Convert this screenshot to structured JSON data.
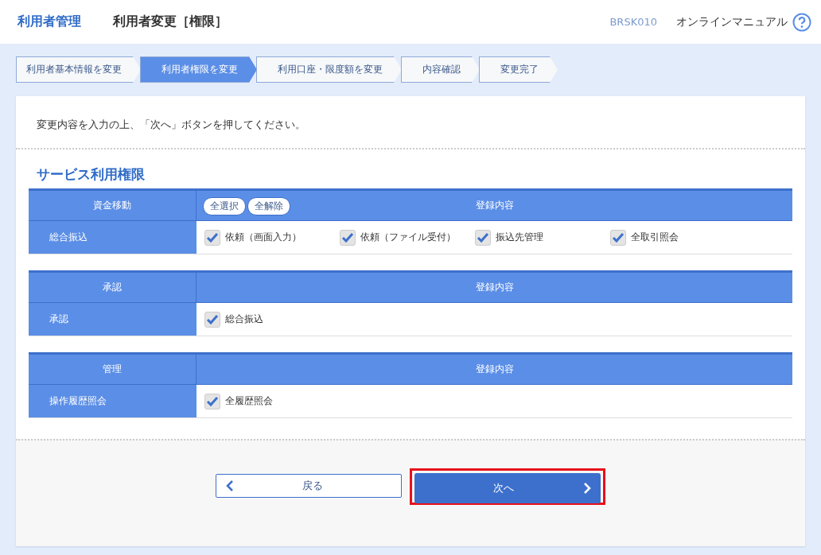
{
  "header": {
    "section": "利用者管理",
    "title": "利用者変更［権限］",
    "screen_id": "BRSK010",
    "manual_link": "オンラインマニュアル"
  },
  "steps": [
    {
      "label": "利用者基本情報を変更",
      "selected": false
    },
    {
      "label": "利用者権限を変更",
      "selected": true
    },
    {
      "label": "利用口座・限度額を変更",
      "selected": false
    },
    {
      "label": "内容確認",
      "selected": false
    },
    {
      "label": "変更完了",
      "selected": false
    }
  ],
  "instruction": "変更内容を入力の上、「次へ」ボタンを押してください。",
  "section_title": "サービス利用権限",
  "tables": [
    {
      "category": "資金移動",
      "buttons": [
        "全選択",
        "全解除"
      ],
      "content_header": "登録内容",
      "rows": [
        {
          "label": "総合振込",
          "options": [
            {
              "label": "依頼（画面入力）",
              "checked": true
            },
            {
              "label": "依頼（ファイル受付）",
              "checked": true
            },
            {
              "label": "振込先管理",
              "checked": true
            },
            {
              "label": "全取引照会",
              "checked": true
            }
          ]
        }
      ]
    },
    {
      "category": "承認",
      "content_header": "登録内容",
      "rows": [
        {
          "label": "承認",
          "options": [
            {
              "label": "総合振込",
              "checked": true
            }
          ]
        }
      ]
    },
    {
      "category": "管理",
      "content_header": "登録内容",
      "rows": [
        {
          "label": "操作履歴照会",
          "options": [
            {
              "label": "全履歴照会",
              "checked": true
            }
          ]
        }
      ]
    }
  ],
  "back_button": {
    "label": "戻る"
  },
  "next_button": {
    "label": "次へ",
    "highlighted": true
  }
}
